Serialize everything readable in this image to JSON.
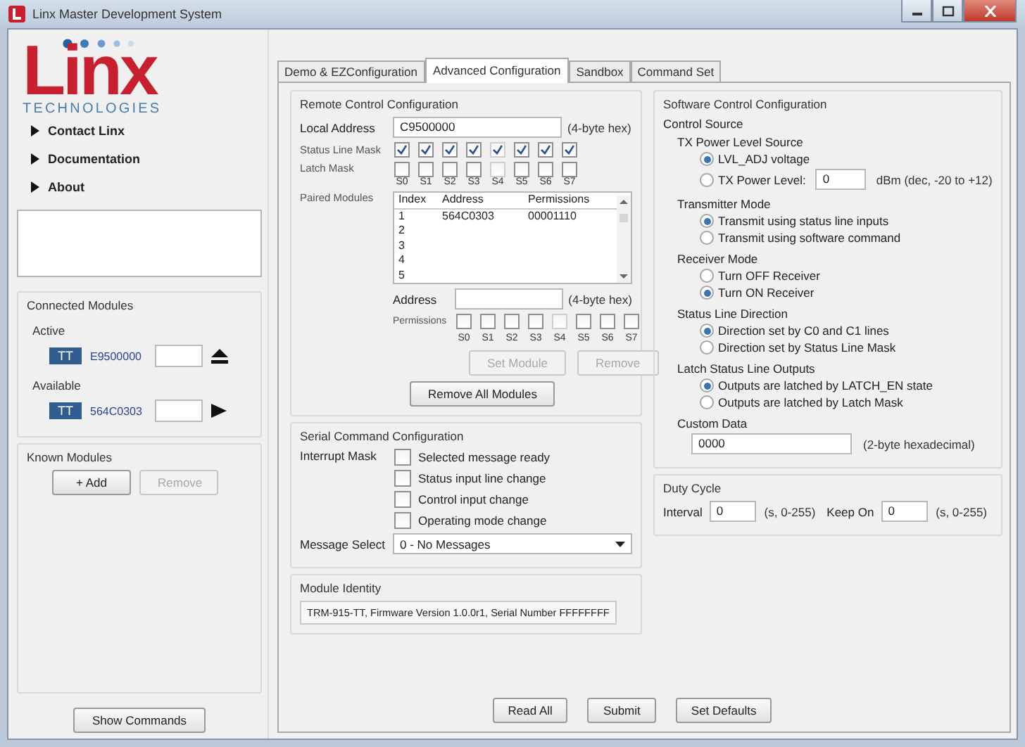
{
  "window": {
    "title": "Linx Master Development System"
  },
  "logo": {
    "name": "Linx",
    "tagline": "TECHNOLOGIES"
  },
  "nav": [
    {
      "label": "Contact Linx"
    },
    {
      "label": "Documentation"
    },
    {
      "label": "About"
    }
  ],
  "connected_modules": {
    "title": "Connected Modules",
    "groups": [
      {
        "label": "Active",
        "badge": "TT",
        "address": "E9500000",
        "kind": "eject"
      },
      {
        "label": "Available",
        "badge": "TT",
        "address": "564C0303",
        "kind": "play"
      }
    ]
  },
  "known_modules": {
    "title": "Known Modules",
    "buttons": [
      {
        "label": "+ Add",
        "disabled": false
      },
      {
        "label": "Remove",
        "disabled": true
      }
    ]
  },
  "show_commands": "Show Commands",
  "tabs": [
    {
      "label": "Demo & EZConfiguration",
      "selected": false
    },
    {
      "label": "Advanced Configuration",
      "selected": true
    },
    {
      "label": "Sandbox",
      "selected": false
    },
    {
      "label": "Command Set",
      "selected": false
    }
  ],
  "remote_control": {
    "title": "Remote Control Configuration",
    "local_address": {
      "label": "Local Address",
      "value": "C9500000",
      "hint": "(4-byte hex)"
    },
    "status_line_mask": {
      "label": "Status Line Mask",
      "checks": [
        {
          "checked": true,
          "disabled": false
        },
        {
          "checked": true,
          "disabled": false
        },
        {
          "checked": true,
          "disabled": false
        },
        {
          "checked": true,
          "disabled": false
        },
        {
          "checked": true,
          "disabled": true
        },
        {
          "checked": true,
          "disabled": false
        },
        {
          "checked": true,
          "disabled": false
        },
        {
          "checked": true,
          "disabled": false
        }
      ]
    },
    "latch_mask": {
      "label": "Latch Mask",
      "checks": [
        {
          "checked": false,
          "disabled": false
        },
        {
          "checked": false,
          "disabled": false
        },
        {
          "checked": false,
          "disabled": false
        },
        {
          "checked": false,
          "disabled": false
        },
        {
          "checked": false,
          "disabled": true
        },
        {
          "checked": false,
          "disabled": false
        },
        {
          "checked": false,
          "disabled": false
        },
        {
          "checked": false,
          "disabled": false
        }
      ],
      "bits": [
        "S0",
        "S1",
        "S2",
        "S3",
        "S4",
        "S5",
        "S6",
        "S7"
      ]
    },
    "paired_modules": {
      "label": "Paired Modules",
      "columns": [
        "Index",
        "Address",
        "Permissions"
      ],
      "rows": [
        [
          "1",
          "564C0303",
          "00001110"
        ],
        [
          "2",
          "",
          ""
        ],
        [
          "3",
          "",
          ""
        ],
        [
          "4",
          "",
          ""
        ],
        [
          "5",
          "",
          ""
        ]
      ]
    },
    "address": {
      "label": "Address",
      "hint": "(4-byte hex)"
    },
    "permissions": {
      "label": "Permissions",
      "checks": [
        {
          "checked": false,
          "disabled": false
        },
        {
          "checked": false,
          "disabled": false
        },
        {
          "checked": false,
          "disabled": false
        },
        {
          "checked": false,
          "disabled": false
        },
        {
          "checked": false,
          "disabled": true
        },
        {
          "checked": false,
          "disabled": false
        },
        {
          "checked": false,
          "disabled": false
        },
        {
          "checked": false,
          "disabled": false
        }
      ],
      "bits": [
        "S0",
        "S1",
        "S2",
        "S3",
        "S4",
        "S5",
        "S6",
        "S7"
      ]
    },
    "buttons": [
      {
        "label": "Set Module",
        "disabled": true
      },
      {
        "label": "Remove",
        "disabled": true
      }
    ],
    "remove_all": "Remove All Modules"
  },
  "serial_command": {
    "title": "Serial Command Configuration",
    "interrupt_mask": {
      "label": "Interrupt Mask",
      "options": [
        {
          "label": "Selected message ready",
          "checked": false
        },
        {
          "label": "Status input line change",
          "checked": false
        },
        {
          "label": "Control input change",
          "checked": false
        },
        {
          "label": "Operating mode change",
          "checked": false
        }
      ]
    },
    "message_select": {
      "label": "Message Select",
      "value": "0 - No Messages"
    }
  },
  "module_identity": {
    "title": "Module Identity",
    "value": "TRM-915-TT, Firmware Version 1.0.0r1, Serial Number FFFFFFFF"
  },
  "software_control": {
    "title": "Software Control Configuration",
    "section": "Control Source",
    "groups": [
      {
        "label": "TX Power Level Source",
        "options": [
          {
            "kind": "plain",
            "label": "LVL_ADJ voltage",
            "selected": true
          },
          {
            "kind": "input",
            "label": "TX Power Level:",
            "selected": false,
            "value": "0",
            "hint": "dBm (dec, -20 to +12)"
          }
        ]
      },
      {
        "label": "Transmitter Mode",
        "options": [
          {
            "kind": "plain",
            "label": "Transmit using status line inputs",
            "selected": true
          },
          {
            "kind": "plain",
            "label": "Transmit using software command",
            "selected": false
          }
        ]
      },
      {
        "label": "Receiver Mode",
        "options": [
          {
            "kind": "plain",
            "label": "Turn OFF Receiver",
            "selected": false
          },
          {
            "kind": "plain",
            "label": "Turn ON Receiver",
            "selected": true
          }
        ]
      },
      {
        "label": "Status Line Direction",
        "options": [
          {
            "kind": "plain",
            "label": "Direction set by C0 and C1 lines",
            "selected": true
          },
          {
            "kind": "plain",
            "label": "Direction set by Status Line Mask",
            "selected": false
          }
        ]
      },
      {
        "label": "Latch Status Line Outputs",
        "options": [
          {
            "kind": "plain",
            "label": "Outputs are latched by LATCH_EN state",
            "selected": true
          },
          {
            "kind": "plain",
            "label": "Outputs are latched by Latch Mask",
            "selected": false
          }
        ]
      }
    ],
    "custom_data": {
      "label": "Custom Data",
      "value": "0000",
      "hint": "(2-byte hexadecimal)"
    }
  },
  "duty_cycle": {
    "title": "Duty Cycle",
    "fields": [
      {
        "label": "Interval",
        "value": "0",
        "hint": "(s, 0-255)"
      },
      {
        "label": "Keep On",
        "value": "0",
        "hint": "(s, 0-255)"
      }
    ]
  },
  "actions": [
    "Read All",
    "Submit",
    "Set Defaults"
  ]
}
